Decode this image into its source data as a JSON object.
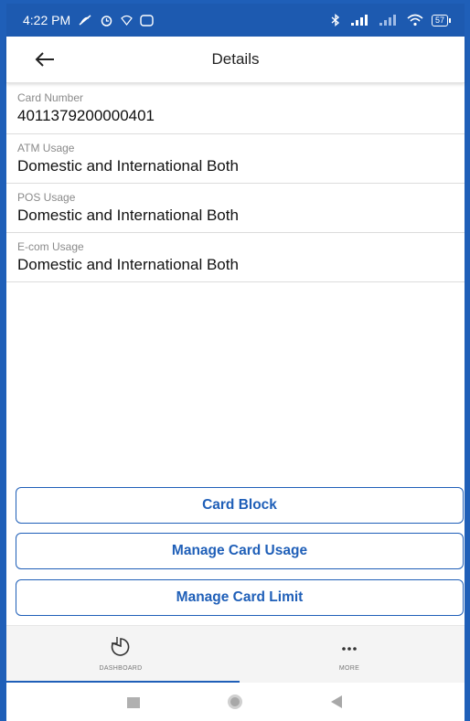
{
  "status_bar": {
    "time": "4:22 PM",
    "battery": "57"
  },
  "header": {
    "title": "Details"
  },
  "details": [
    {
      "label": "Card Number",
      "value": "4011379200000401"
    },
    {
      "label": "ATM Usage",
      "value": "Domestic and International Both"
    },
    {
      "label": "POS Usage",
      "value": "Domestic and International Both"
    },
    {
      "label": "E-com Usage",
      "value": "Domestic and International Both"
    }
  ],
  "actions": {
    "card_block": "Card Block",
    "manage_usage": "Manage Card Usage",
    "manage_limit": "Manage Card Limit"
  },
  "bottom_nav": {
    "dashboard": "DASHBOARD",
    "more": "MORE"
  },
  "colors": {
    "accent": "#1f5fb8",
    "status_bar": "#1d5ab0"
  },
  "icons": {
    "back": "arrow-left-icon",
    "dashboard": "dashboard-icon",
    "more": "more-dots-icon"
  }
}
